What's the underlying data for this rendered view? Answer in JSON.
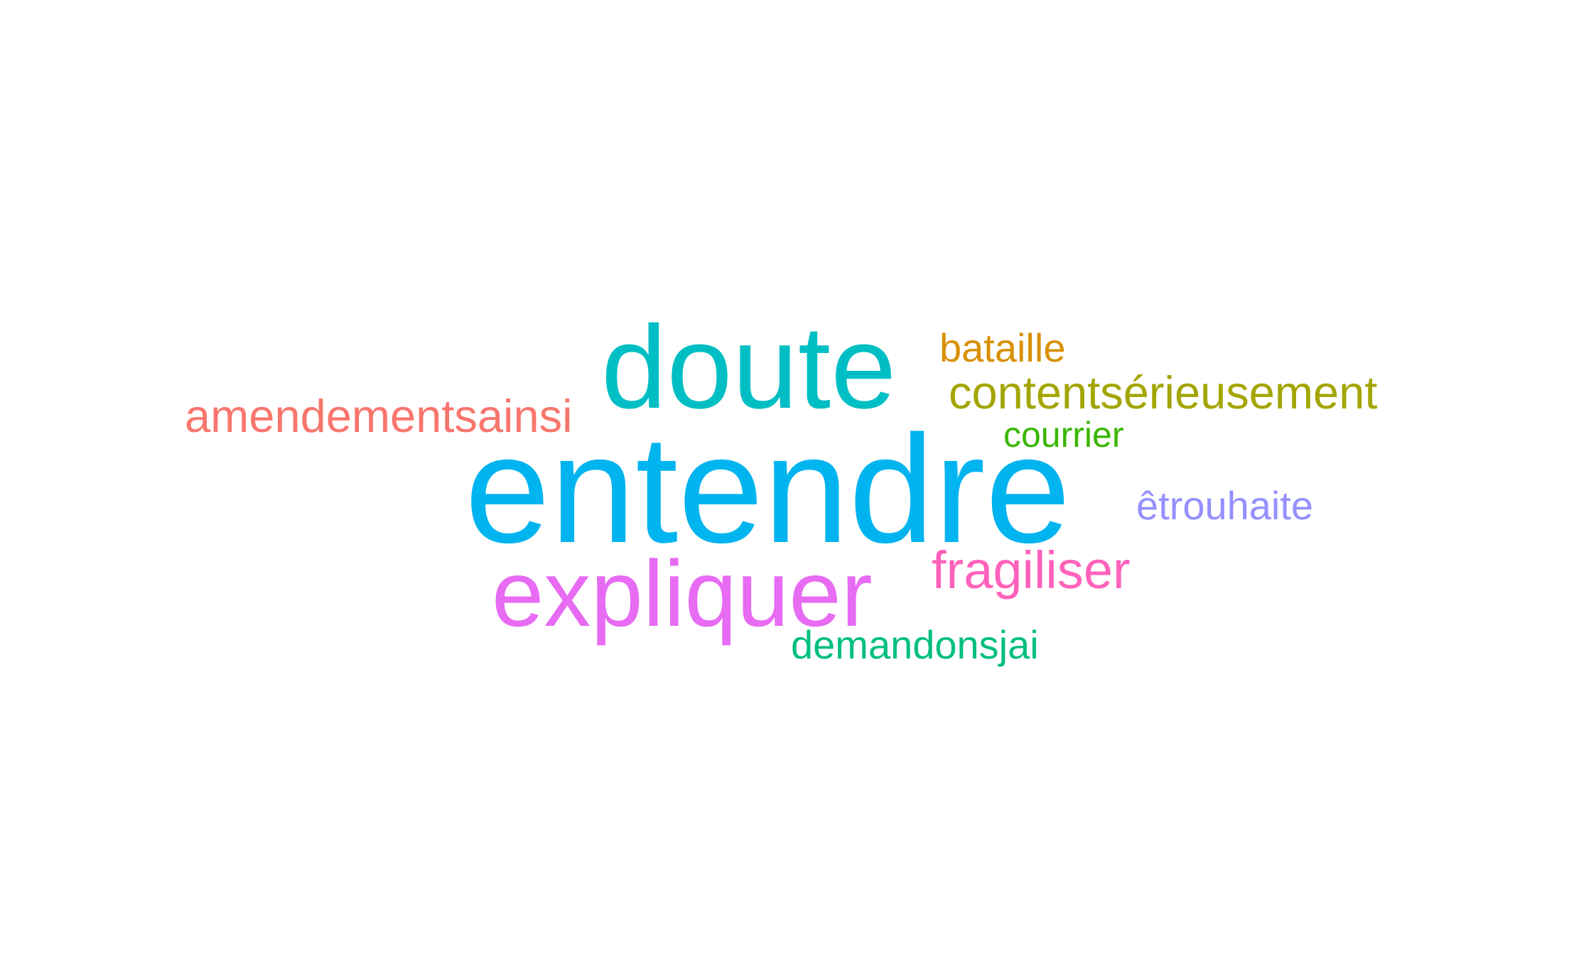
{
  "word_cloud": {
    "words": [
      {
        "text": "entendre",
        "color": "#00B4F0"
      },
      {
        "text": "doute",
        "color": "#00BFC4"
      },
      {
        "text": "expliquer",
        "color": "#E76BF3"
      },
      {
        "text": "amendementsainsi",
        "color": "#F8766D"
      },
      {
        "text": "contentsérieusement",
        "color": "#A3A500"
      },
      {
        "text": "bataille",
        "color": "#D89000"
      },
      {
        "text": "fragiliser",
        "color": "#FF62BC"
      },
      {
        "text": "êtrouhaite",
        "color": "#9590FF"
      },
      {
        "text": "courrier",
        "color": "#39B600"
      },
      {
        "text": "demandonsjai",
        "color": "#00BF7D"
      }
    ]
  }
}
